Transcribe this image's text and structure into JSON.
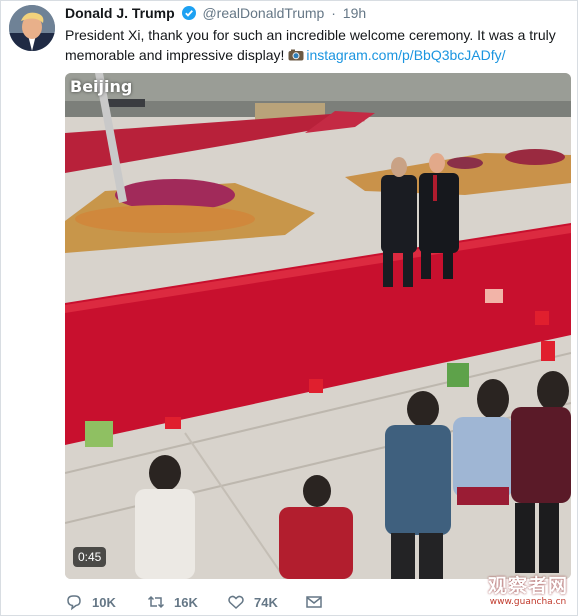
{
  "tweet": {
    "author_name": "Donald J. Trump",
    "handle": "@realDonaldTrump",
    "separator": "·",
    "time": "19h",
    "text": "President Xi, thank you for such an incredible welcome ceremony. It was a truly memorable and impressive display!",
    "link": "instagram.com/p/BbQ3bcJADfy/",
    "icons": {
      "verified": "verified-badge-icon",
      "link_prefix": "camera-icon"
    },
    "colors": {
      "link": "#1b95e0",
      "verified": "#1da1f2",
      "muted": "#657786",
      "carpet": "#c8102e"
    }
  },
  "media": {
    "location_label": "Beijing",
    "duration": "0:45"
  },
  "actions": {
    "reply": {
      "icon": "reply-icon",
      "count": "10K"
    },
    "retweet": {
      "icon": "retweet-icon",
      "count": "16K"
    },
    "like": {
      "icon": "heart-icon",
      "count": "74K"
    },
    "message": {
      "icon": "envelope-icon"
    }
  },
  "watermark": {
    "main": "观察者网",
    "sub": "www.guancha.cn"
  }
}
